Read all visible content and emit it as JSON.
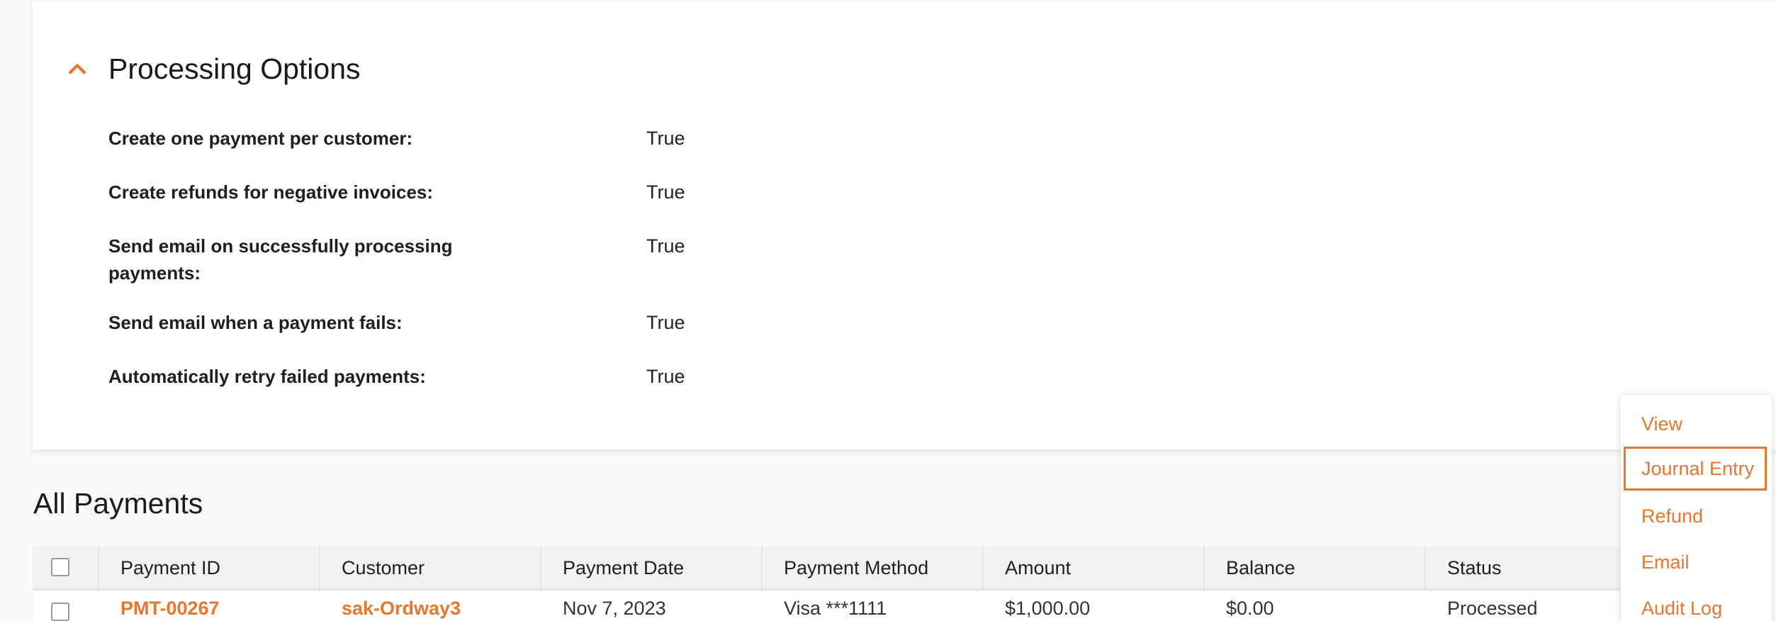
{
  "processing": {
    "title": "Processing Options",
    "options": [
      {
        "label": "Create one payment per customer:",
        "value": "True"
      },
      {
        "label": "Create refunds for negative invoices:",
        "value": "True"
      },
      {
        "label": "Send email on successfully processing payments:",
        "value": "True"
      },
      {
        "label": "Send email when a payment fails:",
        "value": "True"
      },
      {
        "label": "Automatically retry failed payments:",
        "value": "True"
      }
    ]
  },
  "payments": {
    "title": "All Payments",
    "columns": [
      "Payment ID",
      "Customer",
      "Payment Date",
      "Payment Method",
      "Amount",
      "Balance",
      "Status"
    ],
    "rows": [
      {
        "payment_id": "PMT-00267",
        "customer": "sak-Ordway3",
        "payment_date": "Nov 7, 2023",
        "payment_method": "Visa ***1111",
        "amount": "$1,000.00",
        "balance": "$0.00",
        "status": "Processed"
      }
    ]
  },
  "row_menu": {
    "items": [
      "View",
      "Journal Entry",
      "Refund",
      "Email",
      "Audit Log"
    ],
    "focused": "Journal Entry"
  },
  "colors": {
    "accent": "#e6772e"
  }
}
